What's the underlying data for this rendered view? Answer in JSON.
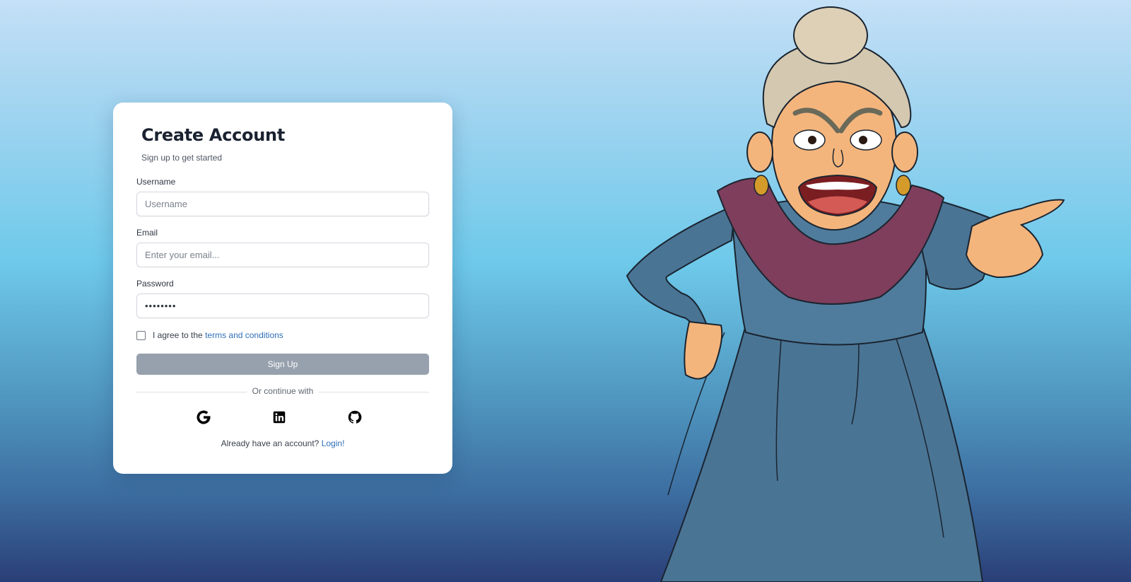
{
  "form": {
    "title": "Create Account",
    "subtitle": "Sign up to get started",
    "username": {
      "label": "Username",
      "placeholder": "Username",
      "value": ""
    },
    "email": {
      "label": "Email",
      "placeholder": "Enter your email...",
      "value": ""
    },
    "password": {
      "label": "Password",
      "value": "••••••••"
    },
    "terms": {
      "prefix": "I agree to the ",
      "link": "terms and conditions",
      "checked": false
    },
    "submit_label": "Sign Up",
    "divider_text": "Or continue with",
    "social": [
      {
        "name": "google",
        "icon": "google-icon"
      },
      {
        "name": "linkedin",
        "icon": "linkedin-icon"
      },
      {
        "name": "github",
        "icon": "github-icon"
      }
    ],
    "footer": {
      "prefix": "Already have an account? ",
      "link": "Login!"
    }
  },
  "colors": {
    "link": "#2f6fb8",
    "button_disabled": "#97a1ad",
    "background_top": "#c4e0f7",
    "background_bottom": "#2a3f77"
  }
}
